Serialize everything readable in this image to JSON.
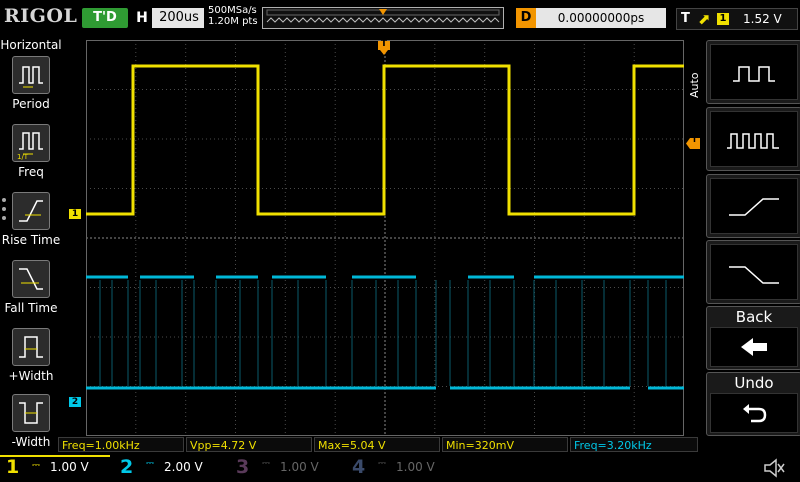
{
  "brand": "RIGOL",
  "trigger_status": "T'D",
  "horizontal": {
    "label": "H",
    "timebase": "200us"
  },
  "sample": {
    "rate": "500MSa/s",
    "points": "1.20M pts"
  },
  "delay": {
    "label": "D",
    "value": "0.00000000ps"
  },
  "trigger": {
    "label": "T",
    "source": "1",
    "level": "1.52 V"
  },
  "left_menu": {
    "title": "Horizontal",
    "items": [
      {
        "label": "Period",
        "icon": "period-icon"
      },
      {
        "label": "Freq",
        "icon": "freq-icon"
      },
      {
        "label": "Rise Time",
        "icon": "rise-time-icon"
      },
      {
        "label": "Fall Time",
        "icon": "fall-time-icon"
      },
      {
        "label": "+Width",
        "icon": "pos-width-icon"
      },
      {
        "label": "-Width",
        "icon": "neg-width-icon"
      }
    ]
  },
  "right_menu": {
    "mode": "Auto",
    "back": "Back",
    "undo": "Undo"
  },
  "markers": {
    "ch1": "1",
    "ch2": "2",
    "trig_pos": "T"
  },
  "measurements": [
    {
      "label": "Freq=1.00kHz",
      "color": "#f0e000"
    },
    {
      "label": "Vpp=4.72 V",
      "color": "#f0e000"
    },
    {
      "label": "Max=5.04 V",
      "color": "#f0e000"
    },
    {
      "label": "Min=320mV",
      "color": "#f0e000"
    },
    {
      "label": "Freq=3.20kHz",
      "color": "#00c8e8"
    }
  ],
  "channels": [
    {
      "num": "1",
      "scale": "1.00 V",
      "color": "#f0e000",
      "active": true
    },
    {
      "num": "2",
      "scale": "2.00 V",
      "color": "#00c8e8",
      "active": true
    },
    {
      "num": "3",
      "scale": "1.00 V",
      "color": "#d040d0",
      "active": false
    },
    {
      "num": "4",
      "scale": "1.00 V",
      "color": "#2060ff",
      "active": false
    }
  ],
  "colors": {
    "ch1": "#f0e000",
    "ch2": "#00c8e8",
    "trigger_marker": "#f29500",
    "grid": "#555555"
  }
}
